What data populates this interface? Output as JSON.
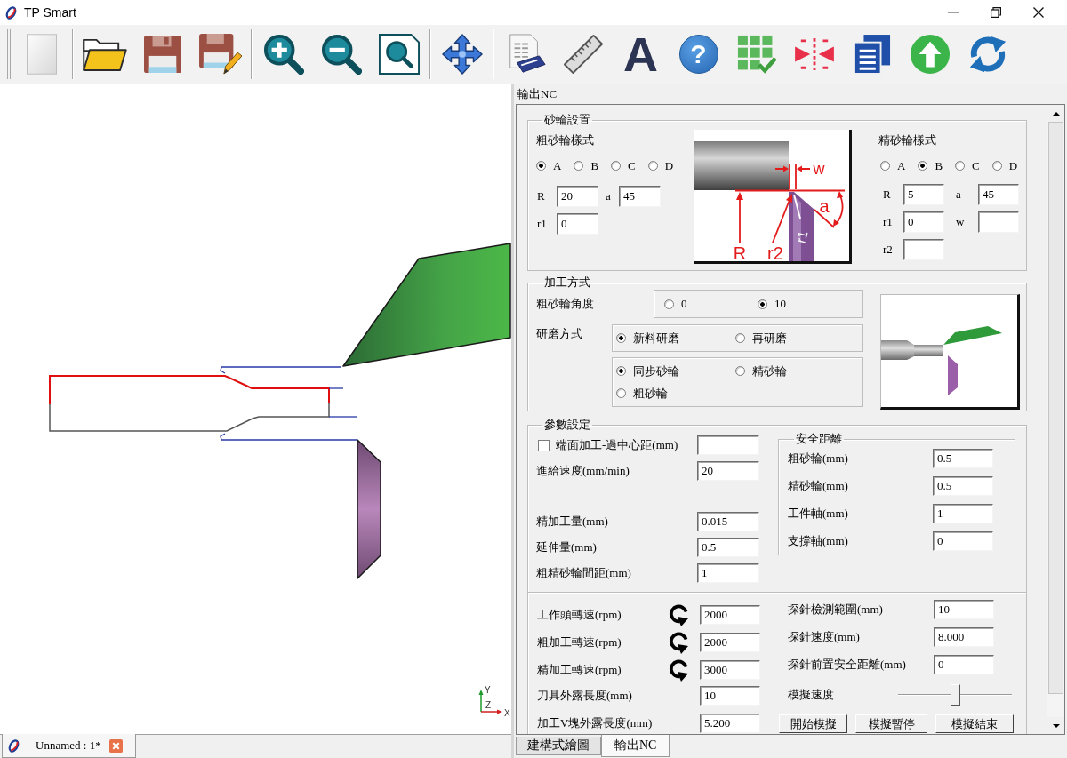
{
  "window": {
    "title": "TP Smart"
  },
  "toolbar": [
    {
      "kind": "grip"
    },
    {
      "kind": "new"
    },
    {
      "kind": "separator"
    },
    {
      "kind": "open"
    },
    {
      "kind": "save"
    },
    {
      "kind": "save-as"
    },
    {
      "kind": "separator"
    },
    {
      "kind": "zoom-in"
    },
    {
      "kind": "zoom-out"
    },
    {
      "kind": "zoom-fit"
    },
    {
      "kind": "separator"
    },
    {
      "kind": "pan"
    },
    {
      "kind": "separator"
    },
    {
      "kind": "print"
    },
    {
      "kind": "ruler"
    },
    {
      "kind": "text",
      "glyph": "A"
    },
    {
      "kind": "help",
      "glyph": "?"
    },
    {
      "kind": "grid-check"
    },
    {
      "kind": "arrows-in"
    },
    {
      "kind": "pages"
    },
    {
      "kind": "upload"
    },
    {
      "kind": "refresh"
    }
  ],
  "canvas": {
    "axis_labels": [
      "Y",
      "Z",
      "X"
    ]
  },
  "document_tab": {
    "label": "Unnamed : 1*"
  },
  "panel": {
    "title": "輸出NC"
  },
  "wheel_settings": {
    "title": "砂輪設置",
    "rough": {
      "title": "粗砂輪樣式",
      "styles": [
        {
          "label": "A",
          "selected": true
        },
        {
          "label": "B",
          "selected": false
        },
        {
          "label": "C",
          "selected": false
        },
        {
          "label": "D",
          "selected": false
        }
      ],
      "rows": [
        [
          {
            "label": "R",
            "value": "20"
          },
          {
            "label": "a",
            "value": "45"
          }
        ],
        [
          {
            "label": "r1",
            "value": "0"
          }
        ]
      ]
    },
    "diagram_labels": [
      "w",
      "a",
      "R",
      "r2",
      "r1"
    ],
    "fine": {
      "title": "精砂輪樣式",
      "styles": [
        {
          "label": "A",
          "selected": false
        },
        {
          "label": "B",
          "selected": true
        },
        {
          "label": "C",
          "selected": false
        },
        {
          "label": "D",
          "selected": false
        }
      ],
      "rows": [
        [
          {
            "label": "R",
            "value": "5"
          },
          {
            "label": "a",
            "value": "45"
          }
        ],
        [
          {
            "label": "r1",
            "value": "0"
          },
          {
            "label": "w"
          }
        ],
        [
          {
            "label": "r2"
          }
        ]
      ]
    }
  },
  "processing": {
    "title": "加工方式",
    "wheel_angle": {
      "label": "粗砂輪角度",
      "options": [
        {
          "label": "0",
          "selected": false
        },
        {
          "label": "10",
          "selected": true
        }
      ]
    },
    "grinding_mode": {
      "label": "研磨方式",
      "options": [
        {
          "label": "新料研磨",
          "selected": true
        },
        {
          "label": "再研磨",
          "selected": false
        }
      ],
      "wheel_options": [
        {
          "label": "同步砂輪",
          "selected": true
        },
        {
          "label": "精砂輪",
          "selected": false
        },
        {
          "label": "粗砂輪",
          "selected": false
        }
      ]
    }
  },
  "parameters": {
    "title": "參數設定",
    "face_offset": {
      "label": "端面加工-過中心距(mm)",
      "checked": false
    },
    "fields": [
      {
        "label": "進給速度(mm/min)",
        "value": "20"
      },
      {
        "label": "精加工量(mm)",
        "value": "0.015"
      },
      {
        "label": "延伸量(mm)",
        "value": "0.5"
      },
      {
        "label": "粗精砂輪間距(mm)",
        "value": "1"
      }
    ],
    "safety": {
      "title": "安全距離",
      "fields": [
        {
          "label": "粗砂輪(mm)",
          "value": "0.5"
        },
        {
          "label": "精砂輪(mm)",
          "value": "0.5"
        },
        {
          "label": "工件軸(mm)",
          "value": "1"
        },
        {
          "label": "支撐軸(mm)",
          "value": "0"
        }
      ]
    },
    "machining": [
      {
        "kind": "speed",
        "label": "工作頭轉速(rpm)",
        "value": "2000"
      },
      {
        "kind": "speed",
        "label": "粗加工轉速(rpm)",
        "value": "2000"
      },
      {
        "kind": "speed",
        "label": "精加工轉速(rpm)",
        "value": "3000"
      },
      {
        "kind": "length",
        "label": "刀具外露長度(mm)",
        "value": "10"
      },
      {
        "kind": "length",
        "label": "加工V塊外露長度(mm)",
        "value": "5.200"
      }
    ],
    "probe": [
      {
        "label": "探針檢測範圍(mm)",
        "value": "10"
      },
      {
        "label": "探針速度(mm)",
        "value": "8.000"
      },
      {
        "label": "探針前置安全距離(mm)",
        "value": "0"
      }
    ],
    "simulation": {
      "label": "模擬速度",
      "level": 0.5,
      "buttons": [
        "開始模擬",
        "模擬暫停",
        "模擬結束"
      ]
    }
  },
  "bottom_tabs": [
    {
      "label": "建構式繪圖",
      "selected": false
    },
    {
      "label": "輸出NC",
      "selected": true
    }
  ]
}
